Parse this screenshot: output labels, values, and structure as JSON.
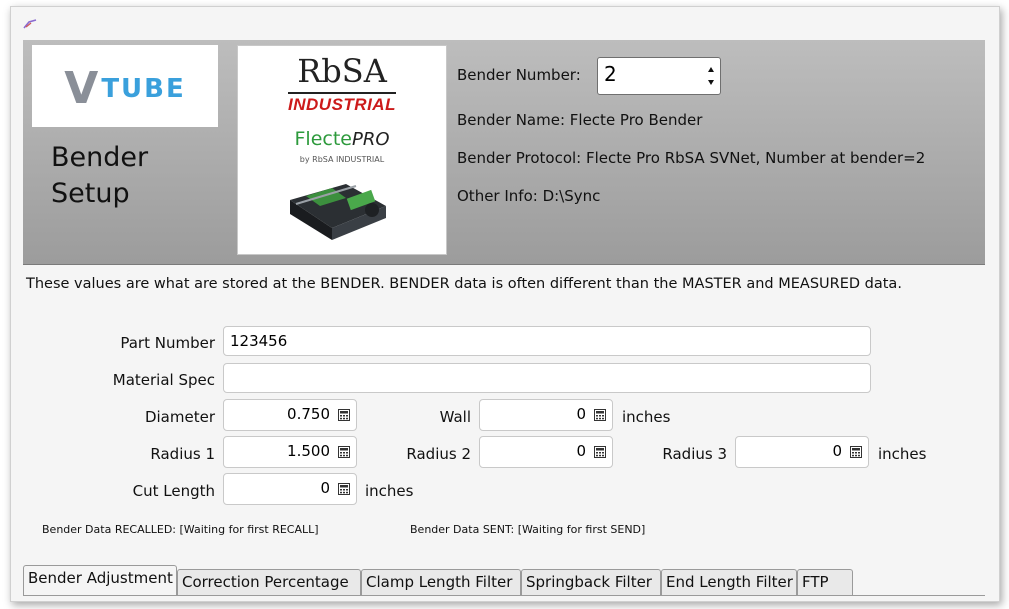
{
  "header": {
    "logo_text_v": "V",
    "logo_text_rest": "TUBE",
    "title_line1": "Bender",
    "title_line2": "Setup",
    "rbsa_title": "RbSA",
    "rbsa_subtitle": "INDUSTRIAL",
    "flecte_text": "Flecte",
    "flecte_pro": "PRO",
    "flecte_by": "by RbSA INDUSTRIAL",
    "bender_number_label": "Bender Number:",
    "bender_number_value": "2",
    "bender_name": "Bender Name: Flecte Pro Bender",
    "bender_protocol": "Bender Protocol: Flecte Pro RbSA SVNet, Number at bender=2",
    "other_info": "Other Info: D:\\Sync"
  },
  "description": "These values are what are stored at the BENDER.  BENDER data is often different than the MASTER and MEASURED data.",
  "form": {
    "part_number_label": "Part Number",
    "part_number_value": "123456",
    "material_spec_label": "Material Spec",
    "material_spec_value": "",
    "diameter_label": "Diameter",
    "diameter_value": "0.750",
    "wall_label": "Wall",
    "wall_value": "0",
    "radius1_label": "Radius 1",
    "radius1_value": "1.500",
    "radius2_label": "Radius 2",
    "radius2_value": "0",
    "radius3_label": "Radius 3",
    "radius3_value": "0",
    "cut_length_label": "Cut Length",
    "cut_length_value": "0",
    "unit_inches": "inches"
  },
  "status": {
    "recalled": "Bender Data RECALLED: [Waiting for first RECALL]",
    "sent": "Bender Data SENT: [Waiting for first SEND]"
  },
  "tabs": [
    {
      "label": "Bender Adjustment"
    },
    {
      "label": "Correction Percentage"
    },
    {
      "label": "Clamp Length Filter"
    },
    {
      "label": "Springback Filter"
    },
    {
      "label": "End Length Filter"
    },
    {
      "label": "FTP"
    }
  ],
  "icons": {
    "app": "app-feather-icon",
    "calculator": "calculator-icon",
    "spinner": "spinner-arrows-icon"
  }
}
